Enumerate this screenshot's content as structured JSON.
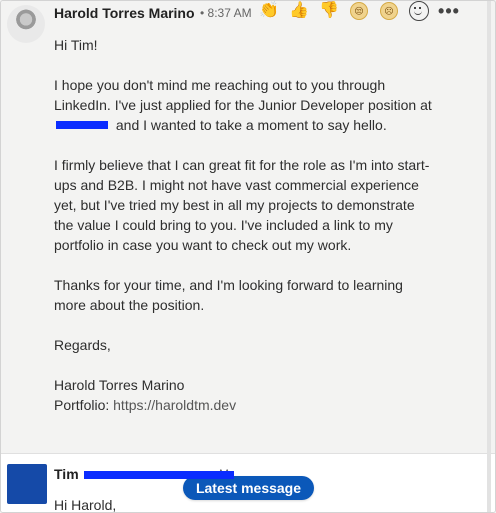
{
  "conversation": {
    "message1": {
      "sender_name": "Harold Torres Marino",
      "time": "• 8:37 AM",
      "greeting": "Hi Tim!",
      "paragraph1_before_redaction": "I hope you don't mind me reaching out to you through LinkedIn. I've just applied for the Junior Developer position at",
      "paragraph1_after_redaction": "and I wanted to take a moment to say hello.",
      "paragraph2": "I firmly believe that I can great fit for the role as I'm into start-ups and B2B. I might not have vast commercial experience yet, but I've tried my best in all my projects to demonstrate the value I could bring to you. I've included a link to my portfolio in case you want to check out my work.",
      "paragraph3": "Thanks for your time, and I'm looking forward to learning more about the position.",
      "closing": "Regards,",
      "signature_name": "Harold Torres Marino",
      "portfolio_label": "Portfolio:",
      "portfolio_link": "https://haroldtm.dev"
    },
    "message2": {
      "sender_name_prefix": "Tim",
      "time_tail": "M",
      "greeting": "Hi Harold,"
    }
  },
  "actions": {
    "latest_message_button": "Latest message"
  },
  "reactions": [
    {
      "name": "celebrate"
    },
    {
      "name": "thumbs-up"
    },
    {
      "name": "thumbs-down"
    },
    {
      "name": "annoyed-face"
    },
    {
      "name": "sad-face"
    },
    {
      "name": "add-reaction"
    },
    {
      "name": "more-options"
    }
  ],
  "colors": {
    "background": "#f3f3f2",
    "redaction": "#0a2cff",
    "latest_button": "#0b58b9",
    "avatar2": "#154aa8"
  }
}
